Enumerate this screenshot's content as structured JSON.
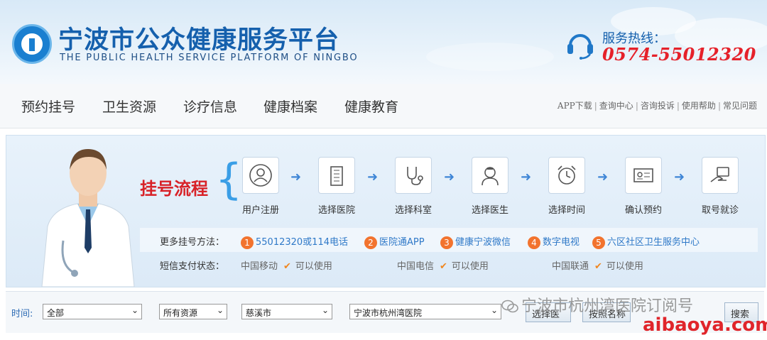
{
  "header": {
    "title": "宁波市公众健康服务平台",
    "subtitle": "THE PUBLIC HEALTH SERVICE PLATFORM OF NINGBO",
    "hotline_label": "服务热线：",
    "hotline_number": "0574-55012320"
  },
  "nav": {
    "items": [
      "预约挂号",
      "卫生资源",
      "诊疗信息",
      "健康档案",
      "健康教育"
    ],
    "links": [
      "APP下载",
      "查询中心",
      "咨询投诉",
      "使用帮助",
      "常见问题"
    ]
  },
  "flow": {
    "title": "挂号流程",
    "steps": [
      {
        "label": "用户注册",
        "icon": "user-icon"
      },
      {
        "label": "选择医院",
        "icon": "hospital-building-icon"
      },
      {
        "label": "选择科室",
        "icon": "stethoscope-icon"
      },
      {
        "label": "选择医生",
        "icon": "doctor-icon"
      },
      {
        "label": "选择时间",
        "icon": "alarm-clock-icon"
      },
      {
        "label": "确认预约",
        "icon": "id-card-icon"
      },
      {
        "label": "取号就诊",
        "icon": "hand-card-icon"
      }
    ]
  },
  "methods": {
    "label": "更多挂号方法：",
    "items": [
      {
        "num": "1",
        "text": "55012320或114电话"
      },
      {
        "num": "2",
        "text": "医院通APP"
      },
      {
        "num": "3",
        "text": "健康宁波微信"
      },
      {
        "num": "4",
        "text": "数字电视"
      },
      {
        "num": "5",
        "text": "六区社区卫生服务中心"
      }
    ]
  },
  "sms": {
    "label": "短信支付状态：",
    "carriers": [
      {
        "name": "中国移动",
        "status": "可以使用"
      },
      {
        "name": "中国电信",
        "status": "可以使用"
      },
      {
        "name": "中国联通",
        "status": "可以使用"
      }
    ]
  },
  "search": {
    "time_label": "时间:",
    "time_value": "全部",
    "resource_value": "所有资源",
    "city_value": "慈溪市",
    "hospital_value": "宁波市杭州湾医院",
    "btn_select": "选择医",
    "btn_filter": "按照名称",
    "btn_search": "搜索"
  },
  "watermark": {
    "account": "宁波市杭州湾医院订阅号",
    "url": "aibaoya.com"
  },
  "colors": {
    "brand_blue": "#1560ad",
    "hotline_red": "#e5212a",
    "flow_red": "#d82228",
    "badge_orange": "#f2732e"
  }
}
